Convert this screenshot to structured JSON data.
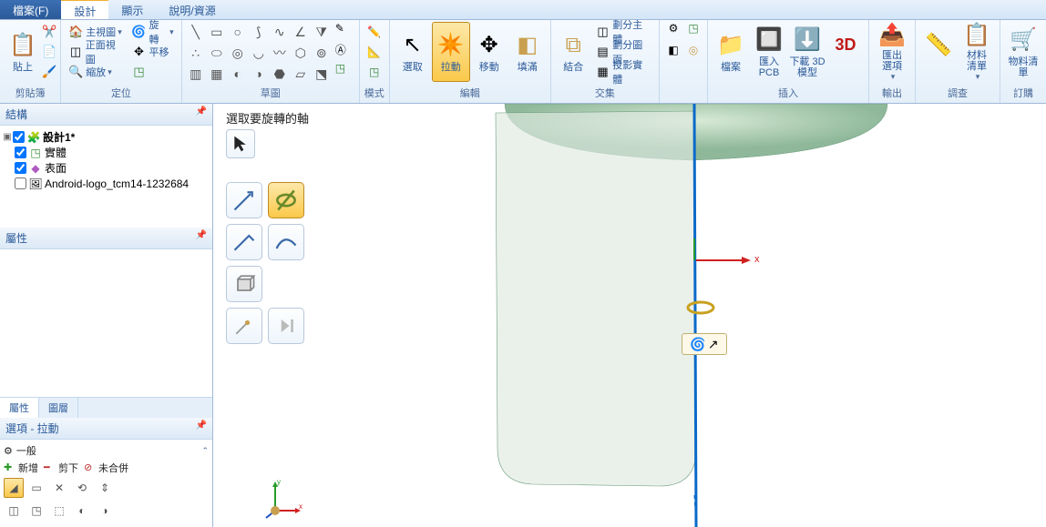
{
  "menu": {
    "file": "檔案(F)",
    "design": "設計",
    "display": "顯示",
    "help": "說明/資源"
  },
  "ribbon": {
    "clipboard": {
      "paste": "貼上",
      "label": "剪貼簿"
    },
    "orient": {
      "home": "主視圖",
      "front": "正面視圖",
      "zoom": "縮放",
      "spin": "旋轉",
      "pan": "平移",
      "label": "定位"
    },
    "sketch": {
      "label": "草圖"
    },
    "mode": {
      "label": "模式"
    },
    "edit": {
      "select": "選取",
      "pull": "拉動",
      "move": "移動",
      "fill": "填滿",
      "label": "編輯"
    },
    "intersect": {
      "combine": "結合",
      "split_body": "劃分主體",
      "split_face": "劃分圖面",
      "project": "投影實體",
      "label": "交集"
    },
    "insert": {
      "file": "檔案",
      "import_pcb": "匯入\nPCB",
      "download_3d": "下載 3D\n模型",
      "label": "插入"
    },
    "output": {
      "export_options": "匯出\n選項",
      "label": "輸出"
    },
    "review": {
      "inspect": "",
      "bom": "材料\n清單",
      "label": "調查"
    },
    "order": {
      "bom_btn": "物料清單",
      "label": "訂購"
    },
    "threeD": "3D"
  },
  "panels": {
    "structure": "結構",
    "properties": "屬性",
    "options_title": "選項 - 拉動",
    "general": "一般",
    "prop_tab": "屬性",
    "layer_tab": "圖層"
  },
  "tree": {
    "root": "設計1*",
    "solid": "實體",
    "surface": "表面",
    "image": "Android-logo_tcm14-1232684"
  },
  "options": {
    "add": "新增",
    "cut": "剪下",
    "nomerge": "未合併"
  },
  "canvas": {
    "hint": "選取要旋轉的軸",
    "axis_x": "x"
  }
}
